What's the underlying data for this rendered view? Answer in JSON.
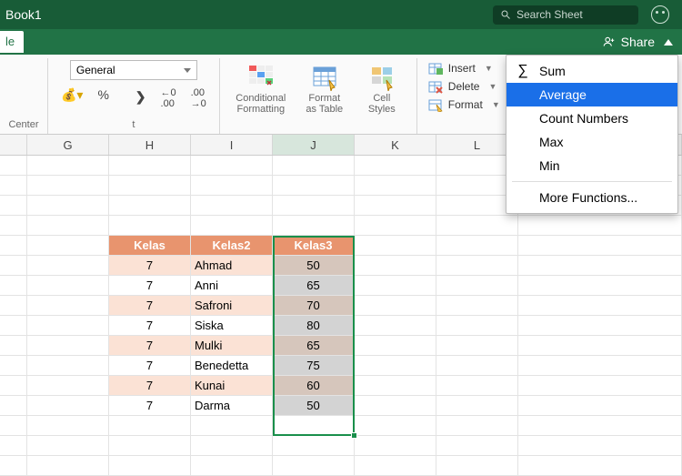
{
  "window": {
    "title": "Book1"
  },
  "search": {
    "placeholder": "Search Sheet"
  },
  "ribbonbar": {
    "active_tab_fragment": "le",
    "share": "Share"
  },
  "ribbon": {
    "align_group_fragment": "Center",
    "numfmt": {
      "combo": "General",
      "label": "t"
    },
    "cond_fmt": "Conditional\nFormatting",
    "fmt_table": "Format\nas Table",
    "cell_styles": "Cell\nStyles",
    "cells": {
      "insert": "Insert",
      "delete": "Delete",
      "format": "Format"
    }
  },
  "dropdown": {
    "sum": "Sum",
    "average": "Average",
    "count": "Count Numbers",
    "max": "Max",
    "min": "Min",
    "more": "More Functions..."
  },
  "columns": [
    "",
    "G",
    "H",
    "I",
    "J",
    "K",
    "L",
    ""
  ],
  "table": {
    "headers": [
      "Kelas",
      "Kelas2",
      "Kelas3"
    ],
    "rows": [
      {
        "kelas": "7",
        "kelas2": "Ahmad",
        "kelas3": "50"
      },
      {
        "kelas": "7",
        "kelas2": "Anni",
        "kelas3": "65"
      },
      {
        "kelas": "7",
        "kelas2": "Safroni",
        "kelas3": "70"
      },
      {
        "kelas": "7",
        "kelas2": "Siska",
        "kelas3": "80"
      },
      {
        "kelas": "7",
        "kelas2": "Mulki",
        "kelas3": "65"
      },
      {
        "kelas": "7",
        "kelas2": "Benedetta",
        "kelas3": "75"
      },
      {
        "kelas": "7",
        "kelas2": "Kunai",
        "kelas3": "60"
      },
      {
        "kelas": "7",
        "kelas2": "Darma",
        "kelas3": "50"
      }
    ]
  }
}
